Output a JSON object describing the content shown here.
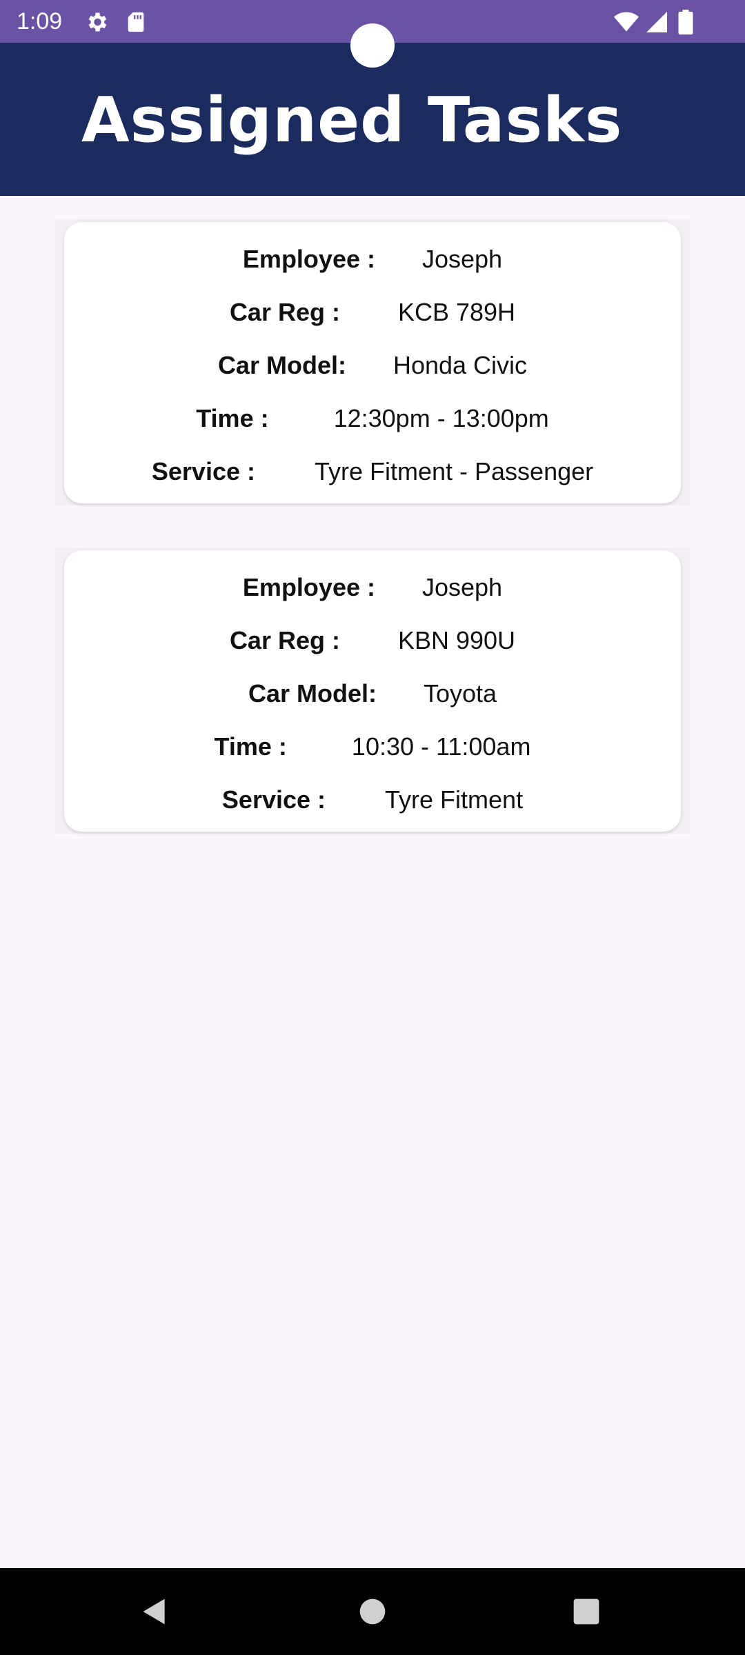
{
  "status_bar": {
    "time": "1:09",
    "icons": [
      "settings-icon",
      "sd-card-icon",
      "wifi-icon",
      "cellular-signal-icon",
      "battery-icon"
    ]
  },
  "header": {
    "title": "Assigned Tasks"
  },
  "labels": {
    "employee": "Employee :",
    "car_reg": "Car Reg :",
    "car_model": "Car Model:",
    "time": "Time :",
    "service": "Service :"
  },
  "tasks": [
    {
      "employee": "Joseph",
      "car_reg": "KCB 789H",
      "car_model": "Honda Civic",
      "time": "12:30pm - 13:00pm",
      "service": "Tyre Fitment - Passenger"
    },
    {
      "employee": "Joseph",
      "car_reg": "KBN 990U",
      "car_model": "Toyota",
      "time": "10:30 - 11:00am",
      "service": "Tyre Fitment"
    }
  ],
  "nav_bar": {
    "icons": [
      "back-icon",
      "home-icon",
      "recents-icon"
    ]
  },
  "colors": {
    "status_bar": "#6a52a5",
    "header": "#1c2b5e",
    "background": "#fcf5fd",
    "card": "#ffffff",
    "nav_bar": "#000000"
  }
}
